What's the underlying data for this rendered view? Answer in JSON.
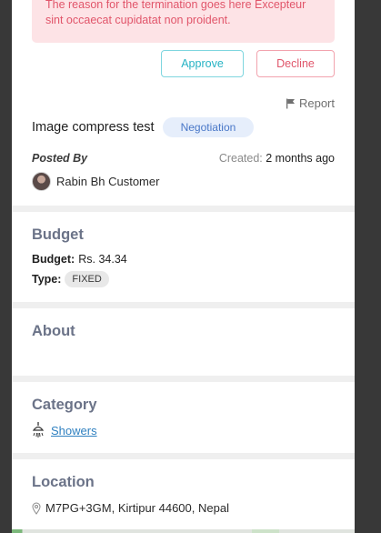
{
  "termination_request": {
    "message": "The reason for the termination goes here Excepteur sint occaecat cupidatat non proident.",
    "approve_label": "Approve",
    "decline_label": "Decline"
  },
  "report_label": "Report",
  "job": {
    "title": "Image compress test",
    "status": "Negotiation",
    "posted_by_label": "Posted By",
    "created_label": "Created:",
    "created_value": "2 months ago",
    "poster_name": "Rabin Bh Customer"
  },
  "budget": {
    "heading": "Budget",
    "budget_label": "Budget:",
    "budget_value": "Rs. 34.34",
    "type_label": "Type:",
    "type_value": "FIXED"
  },
  "about": {
    "heading": "About"
  },
  "category": {
    "heading": "Category",
    "name": "Showers",
    "icon": "shower-icon"
  },
  "location": {
    "heading": "Location",
    "address": "M7PG+3GM, Kirtipur 44600, Nepal",
    "icon": "map-pin-icon"
  },
  "colors": {
    "alert_bg": "#fde3e6",
    "alert_text": "#e1556a",
    "approve": "#26b3c4",
    "decline": "#e0566b",
    "status_pill_bg": "#e6eefb",
    "status_pill_text": "#4a78c8",
    "section_heading": "#6b7388",
    "link": "#2f80c0"
  }
}
